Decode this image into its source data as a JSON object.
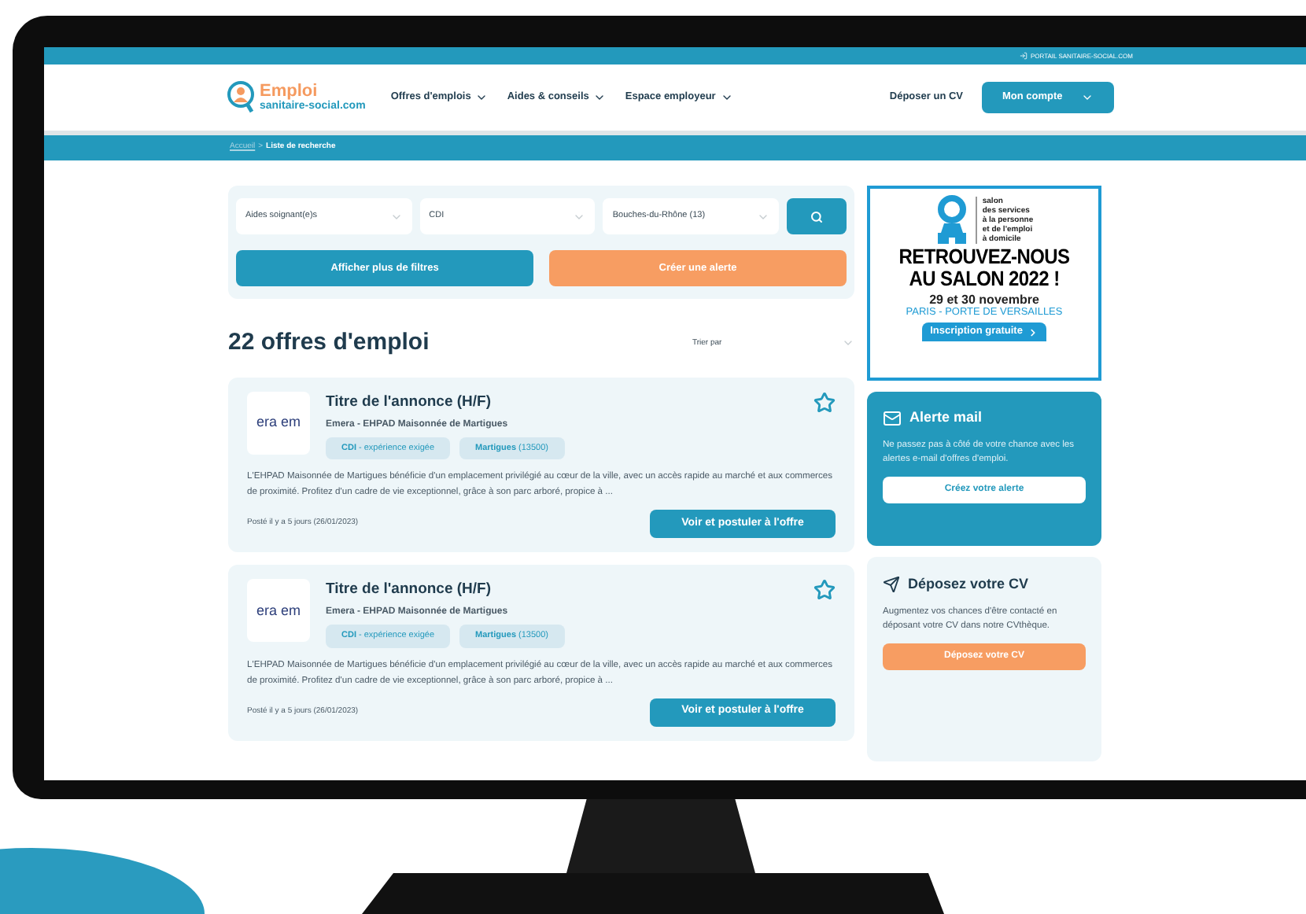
{
  "top_bar": {
    "link": "PORTAIL SANITAIRE-SOCIAL.COM"
  },
  "header": {
    "logo": {
      "line1": "Emploi",
      "line2": "sanitaire-social.com"
    },
    "nav": [
      {
        "label": "Offres d'emplois"
      },
      {
        "label": "Aides & conseils"
      },
      {
        "label": "Espace employeur"
      }
    ],
    "cv_link": "Déposer un CV",
    "account_button": "Mon compte"
  },
  "breadcrumb": {
    "items": [
      {
        "label": "Accueil",
        "kind": "link"
      },
      {
        "label": "Liste de recherche",
        "kind": "current"
      }
    ],
    "separator": ">"
  },
  "search": {
    "fields": [
      {
        "value": "Aides soignant(e)s"
      },
      {
        "value": "CDI"
      },
      {
        "value": "Bouches-du-Rhône (13)"
      }
    ],
    "more_filters_button": "Afficher plus de filtres",
    "alert_button": "Créer une alerte"
  },
  "results": {
    "heading": "22 offres d'emploi",
    "sort": {
      "placeholder": "Trier par"
    }
  },
  "offers": [
    {
      "logo_text": "era em",
      "title": "Titre de l'annonce (H/F)",
      "company": "Emera - EHPAD Maisonnée de Martigues",
      "favorite": false,
      "tags": [
        {
          "label": "CDI",
          "detail": "- expérience exigée"
        },
        {
          "label": "Martigues",
          "detail": "(13500)"
        }
      ],
      "description": "L'EHPAD Maisonnée de Martigues bénéficie d'un emplacement privilégié au cœur de la ville, avec un accès rapide au marché et aux commerces de proximité. Profitez d'un cadre de vie exceptionnel, grâce à son parc arboré, propice à ...",
      "posted": "Posté il y a 5 jours (26/01/2023)",
      "apply_button": "Voir et postuler à l'offre"
    },
    {
      "logo_text": "era em",
      "title": "Titre de l'annonce (H/F)",
      "company": "Emera - EHPAD Maisonnée de Martigues",
      "favorite": false,
      "tags": [
        {
          "label": "CDI",
          "detail": "- expérience exigée"
        },
        {
          "label": "Martigues",
          "detail": "(13500)"
        }
      ],
      "description": "L'EHPAD Maisonnée de Martigues bénéficie d'un emplacement privilégié au cœur de la ville, avec un accès rapide au marché et aux commerces de proximité. Profitez d'un cadre de vie exceptionnel, grâce à son parc arboré, propice à ...",
      "posted": "Posté il y a 5 jours (26/01/2023)",
      "apply_button": "Voir et postuler à l'offre"
    }
  ],
  "sidebar": {
    "banner": {
      "logo_lines": [
        "salon",
        "des services",
        "à la personne",
        "et de l'emploi",
        "à domicile"
      ],
      "headline": [
        "RETROUVEZ-NOUS",
        "AU SALON 2022 !"
      ],
      "dates": "29 et 30 novembre",
      "venue": "PARIS - PORTE DE VERSAILLES",
      "cta": "Inscription gratuite"
    },
    "alert_card": {
      "title": "Alerte mail",
      "text": "Ne passez pas à côté de votre chance avec les alertes e-mail d'offres d'emploi.",
      "button": "Créez votre alerte"
    },
    "cv_card": {
      "title": "Déposez votre CV",
      "text": "Augmentez vos chances d'être contacté en déposant votre CV dans notre CVthèque.",
      "button": "Déposez votre CV"
    }
  }
}
